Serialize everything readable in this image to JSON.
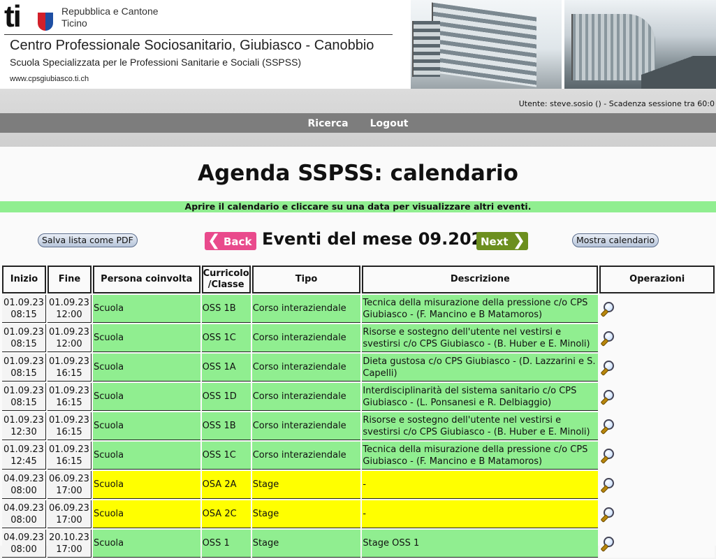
{
  "header": {
    "logo_text": "ti",
    "republic_line1": "Repubblica e Cantone",
    "republic_line2": "Ticino",
    "institute": "Centro Professionale Sociosanitario, Giubiasco - Canobbio",
    "school": "Scuola Specializzata per le Professioni Sanitarie e Sociali (SSPSS)",
    "website": "www.cpsgiubiasco.ti.ch"
  },
  "session": {
    "text": "Utente: steve.sosio () - Scadenza sessione tra 60:0"
  },
  "nav": {
    "items": [
      "Ricerca",
      "Logout"
    ]
  },
  "page": {
    "title": "Agenda SSPSS: calendario",
    "info": "Aprire il calendario e cliccare su una data per visualizzare altri eventi.",
    "pdf_button": "Salva lista come PDF",
    "back_button": "Back",
    "next_button": "Next",
    "month_title": "Eventi del mese 09.2023",
    "calendar_button": "Mostra calendario"
  },
  "table": {
    "headers": {
      "inizio": "Inizio",
      "fine": "Fine",
      "persona": "Persona coinvolta",
      "curricolo_l1": "Curricolo",
      "curricolo_l2": "/Classe",
      "tipo": "Tipo",
      "descrizione": "Descrizione",
      "operazioni": "Operazioni"
    },
    "rows": [
      {
        "start_date": "01.09.23",
        "start_time": "08:15",
        "end_date": "01.09.23",
        "end_time": "12:00",
        "persona": "Scuola",
        "classe": "OSS 1B",
        "tipo": "Corso interaziendale",
        "descrizione": "Tecnica della misurazione della pressione c/o CPS Giubiasco - (F. Mancino e B Matamoros)",
        "status": "green"
      },
      {
        "start_date": "01.09.23",
        "start_time": "08:15",
        "end_date": "01.09.23",
        "end_time": "12:00",
        "persona": "Scuola",
        "classe": "OSS 1C",
        "tipo": "Corso interaziendale",
        "descrizione": "Risorse e sostegno dell'utente nel vestirsi e svestirsi c/o CPS Giubiasco - (B. Huber e E. Minoli)",
        "status": "green"
      },
      {
        "start_date": "01.09.23",
        "start_time": "08:15",
        "end_date": "01.09.23",
        "end_time": "16:15",
        "persona": "Scuola",
        "classe": "OSS 1A",
        "tipo": "Corso interaziendale",
        "descrizione": "Dieta gustosa c/o CPS Giubiasco - (D. Lazzarini e S. Capelli)",
        "status": "green"
      },
      {
        "start_date": "01.09.23",
        "start_time": "08:15",
        "end_date": "01.09.23",
        "end_time": "16:15",
        "persona": "Scuola",
        "classe": "OSS 1D",
        "tipo": "Corso interaziendale",
        "descrizione": "Interdisciplinarità del sistema sanitario c/o CPS Giubiasco - (L. Ponsanesi e R. Delbiaggio)",
        "status": "green"
      },
      {
        "start_date": "01.09.23",
        "start_time": "12:30",
        "end_date": "01.09.23",
        "end_time": "16:15",
        "persona": "Scuola",
        "classe": "OSS 1B",
        "tipo": "Corso interaziendale",
        "descrizione": "Risorse e sostegno dell'utente nel vestirsi e svestirsi c/o CPS Giubiasco - (B. Huber e E. Minoli)",
        "status": "green"
      },
      {
        "start_date": "01.09.23",
        "start_time": "12:45",
        "end_date": "01.09.23",
        "end_time": "16:15",
        "persona": "Scuola",
        "classe": "OSS 1C",
        "tipo": "Corso interaziendale",
        "descrizione": "Tecnica della misurazione della pressione c/o CPS Giubiasco - (F. Mancino e B Matamoros)",
        "status": "green"
      },
      {
        "start_date": "04.09.23",
        "start_time": "08:00",
        "end_date": "06.09.23",
        "end_time": "17:00",
        "persona": "Scuola",
        "classe": "OSA 2A",
        "tipo": "Stage",
        "descrizione": "-",
        "status": "yellow"
      },
      {
        "start_date": "04.09.23",
        "start_time": "08:00",
        "end_date": "06.09.23",
        "end_time": "17:00",
        "persona": "Scuola",
        "classe": "OSA 2C",
        "tipo": "Stage",
        "descrizione": "-",
        "status": "yellow"
      },
      {
        "start_date": "04.09.23",
        "start_time": "08:00",
        "end_date": "20.10.23",
        "end_time": "17:00",
        "persona": "Scuola",
        "classe": "OSS 1",
        "tipo": "Stage",
        "descrizione": "Stage OSS 1",
        "status": "green"
      }
    ]
  },
  "colors": {
    "green": "#90ee90",
    "yellow": "#ffff00",
    "nav": "#7d7d7d",
    "back": "#e94a8c",
    "next": "#6c8f1f"
  },
  "icons": {
    "row_action": "magnifier-icon"
  }
}
